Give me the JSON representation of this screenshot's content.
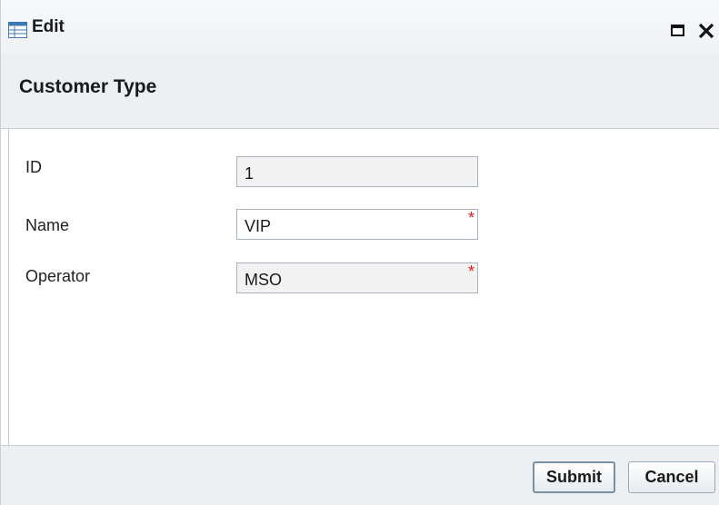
{
  "window": {
    "title": "Edit",
    "title_icon": "table-grid-icon",
    "maximize_icon": "maximize-icon",
    "close_icon": "close-icon"
  },
  "header": {
    "title": "Customer Type"
  },
  "form": {
    "fields": [
      {
        "label": "ID",
        "value": "1",
        "readonly": true,
        "required": false
      },
      {
        "label": "Name",
        "value": "VIP",
        "readonly": false,
        "required": true
      },
      {
        "label": "Operator",
        "value": "MSO",
        "readonly": true,
        "required": true
      }
    ],
    "required_marker": "*"
  },
  "footer": {
    "submit_label": "Submit",
    "cancel_label": "Cancel"
  },
  "colors": {
    "required_marker": "#e21b1b",
    "panel_background": "#edf0f3",
    "border": "#c6ced6"
  }
}
